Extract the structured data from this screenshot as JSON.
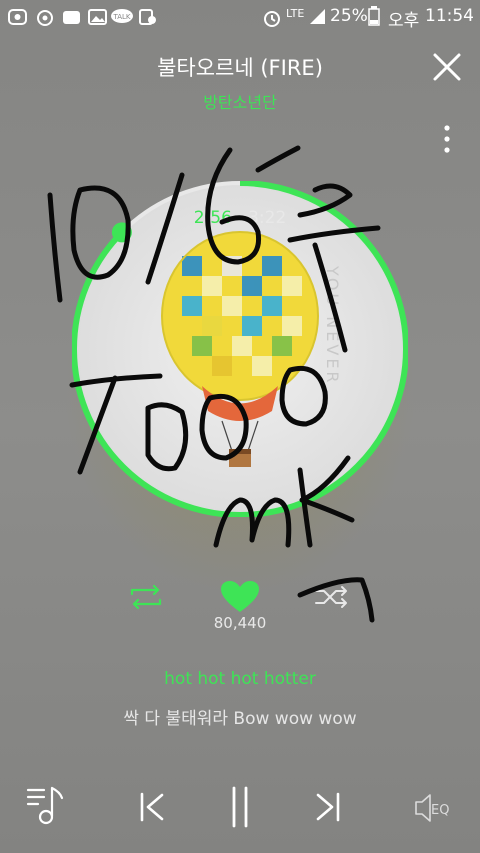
{
  "status_bar": {
    "network": "LTE",
    "battery": "25%",
    "ampm": "오후",
    "time": "11:54",
    "talk_badge": "TALK"
  },
  "player": {
    "title": "불타오르네 (FIRE)",
    "artist": "방탄소년단",
    "elapsed": "2:56",
    "separator": "·",
    "duration": "3:22",
    "progress": 0.874,
    "like_count": "80,440",
    "liked": true,
    "lyric_current": "hot hot hot hotter",
    "lyric_next": "싹 다 불태워라 Bow wow wow"
  },
  "icons": {
    "close": "close-icon",
    "more": "more-vertical-icon",
    "repeat": "repeat-icon",
    "like": "heart-icon",
    "shuffle": "shuffle-icon",
    "playlist": "playlist-icon",
    "prev": "previous-icon",
    "pause": "pause-icon",
    "next": "next-icon",
    "eq": "equalizer-icon",
    "eq_label": "EQ"
  },
  "colors": {
    "accent": "#3ee456",
    "background": "#8a8a88"
  }
}
